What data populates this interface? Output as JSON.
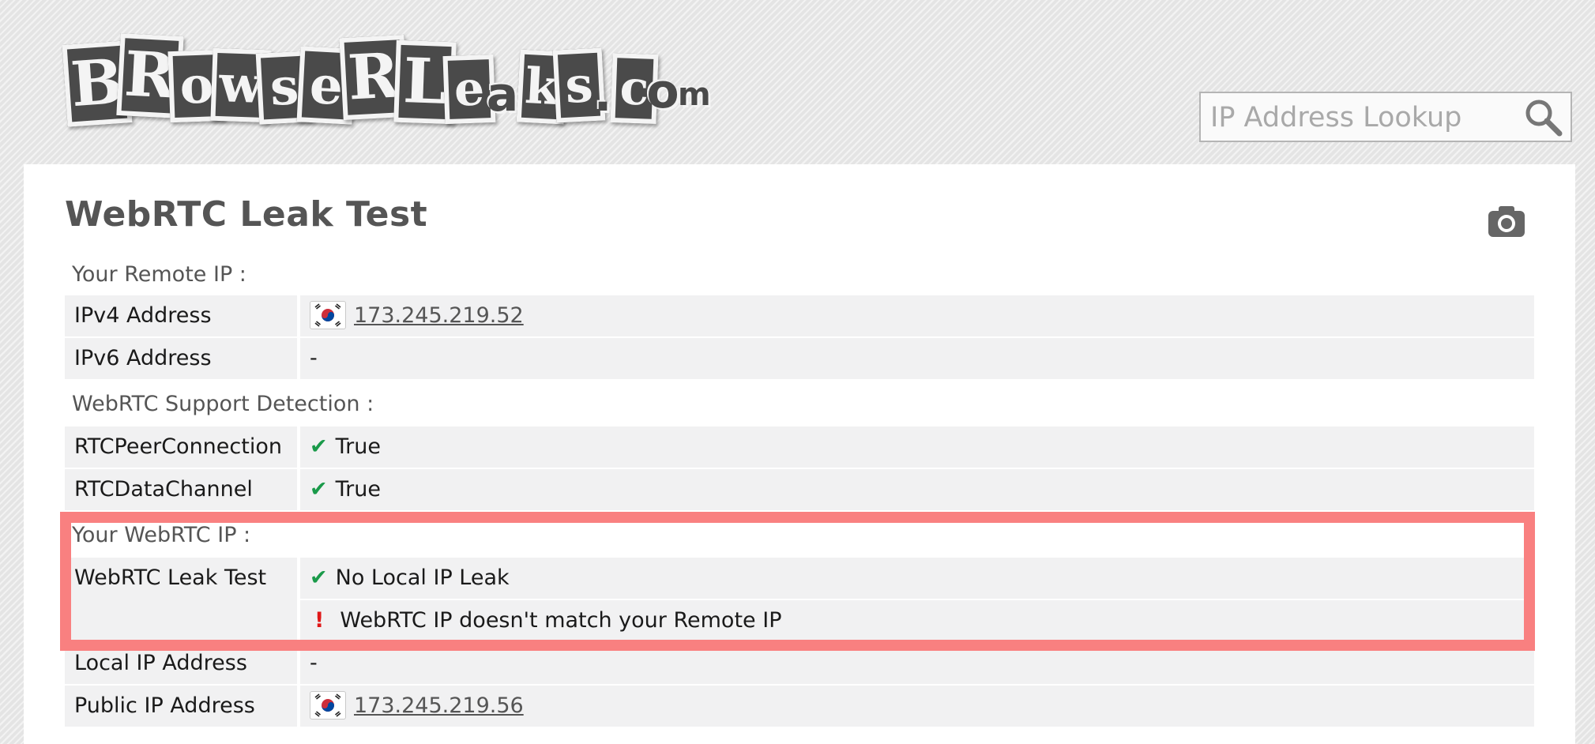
{
  "header": {
    "logo_letters": [
      "B",
      "R",
      "o",
      "w",
      "s",
      "e",
      "R",
      "L",
      "e",
      "a",
      "k",
      "s",
      ".",
      "c",
      "o",
      "m"
    ],
    "search": {
      "placeholder": "IP Address Lookup"
    }
  },
  "main": {
    "title": "WebRTC Leak Test",
    "sections": {
      "remote_ip": {
        "label": "Your Remote IP :",
        "rows": [
          {
            "key": "IPv4 Address",
            "value": "173.245.219.52",
            "flag": "south-korea-flag-icon"
          },
          {
            "key": "IPv6 Address",
            "value": "-"
          }
        ]
      },
      "support": {
        "label": "WebRTC Support Detection :",
        "rows": [
          {
            "key": "RTCPeerConnection",
            "value": "True",
            "icon": "check-icon"
          },
          {
            "key": "RTCDataChannel",
            "value": "True",
            "icon": "check-icon"
          }
        ]
      },
      "webrtc_ip": {
        "label": "Your WebRTC IP :",
        "rows": [
          {
            "key": "WebRTC Leak Test",
            "value": "No Local IP Leak",
            "icon": "check-icon"
          },
          {
            "key": "",
            "value": "WebRTC IP doesn't match your Remote IP",
            "icon": "warning-icon"
          },
          {
            "key": "Local IP Address",
            "value": "-"
          },
          {
            "key": "Public IP Address",
            "value": "173.245.219.56",
            "flag": "south-korea-flag-icon"
          }
        ]
      }
    },
    "icons": {
      "check": "✔",
      "warning": "!"
    }
  },
  "colors": {
    "check": "#1a9a4a",
    "warning": "#e01818",
    "highlight": "#f98080"
  }
}
